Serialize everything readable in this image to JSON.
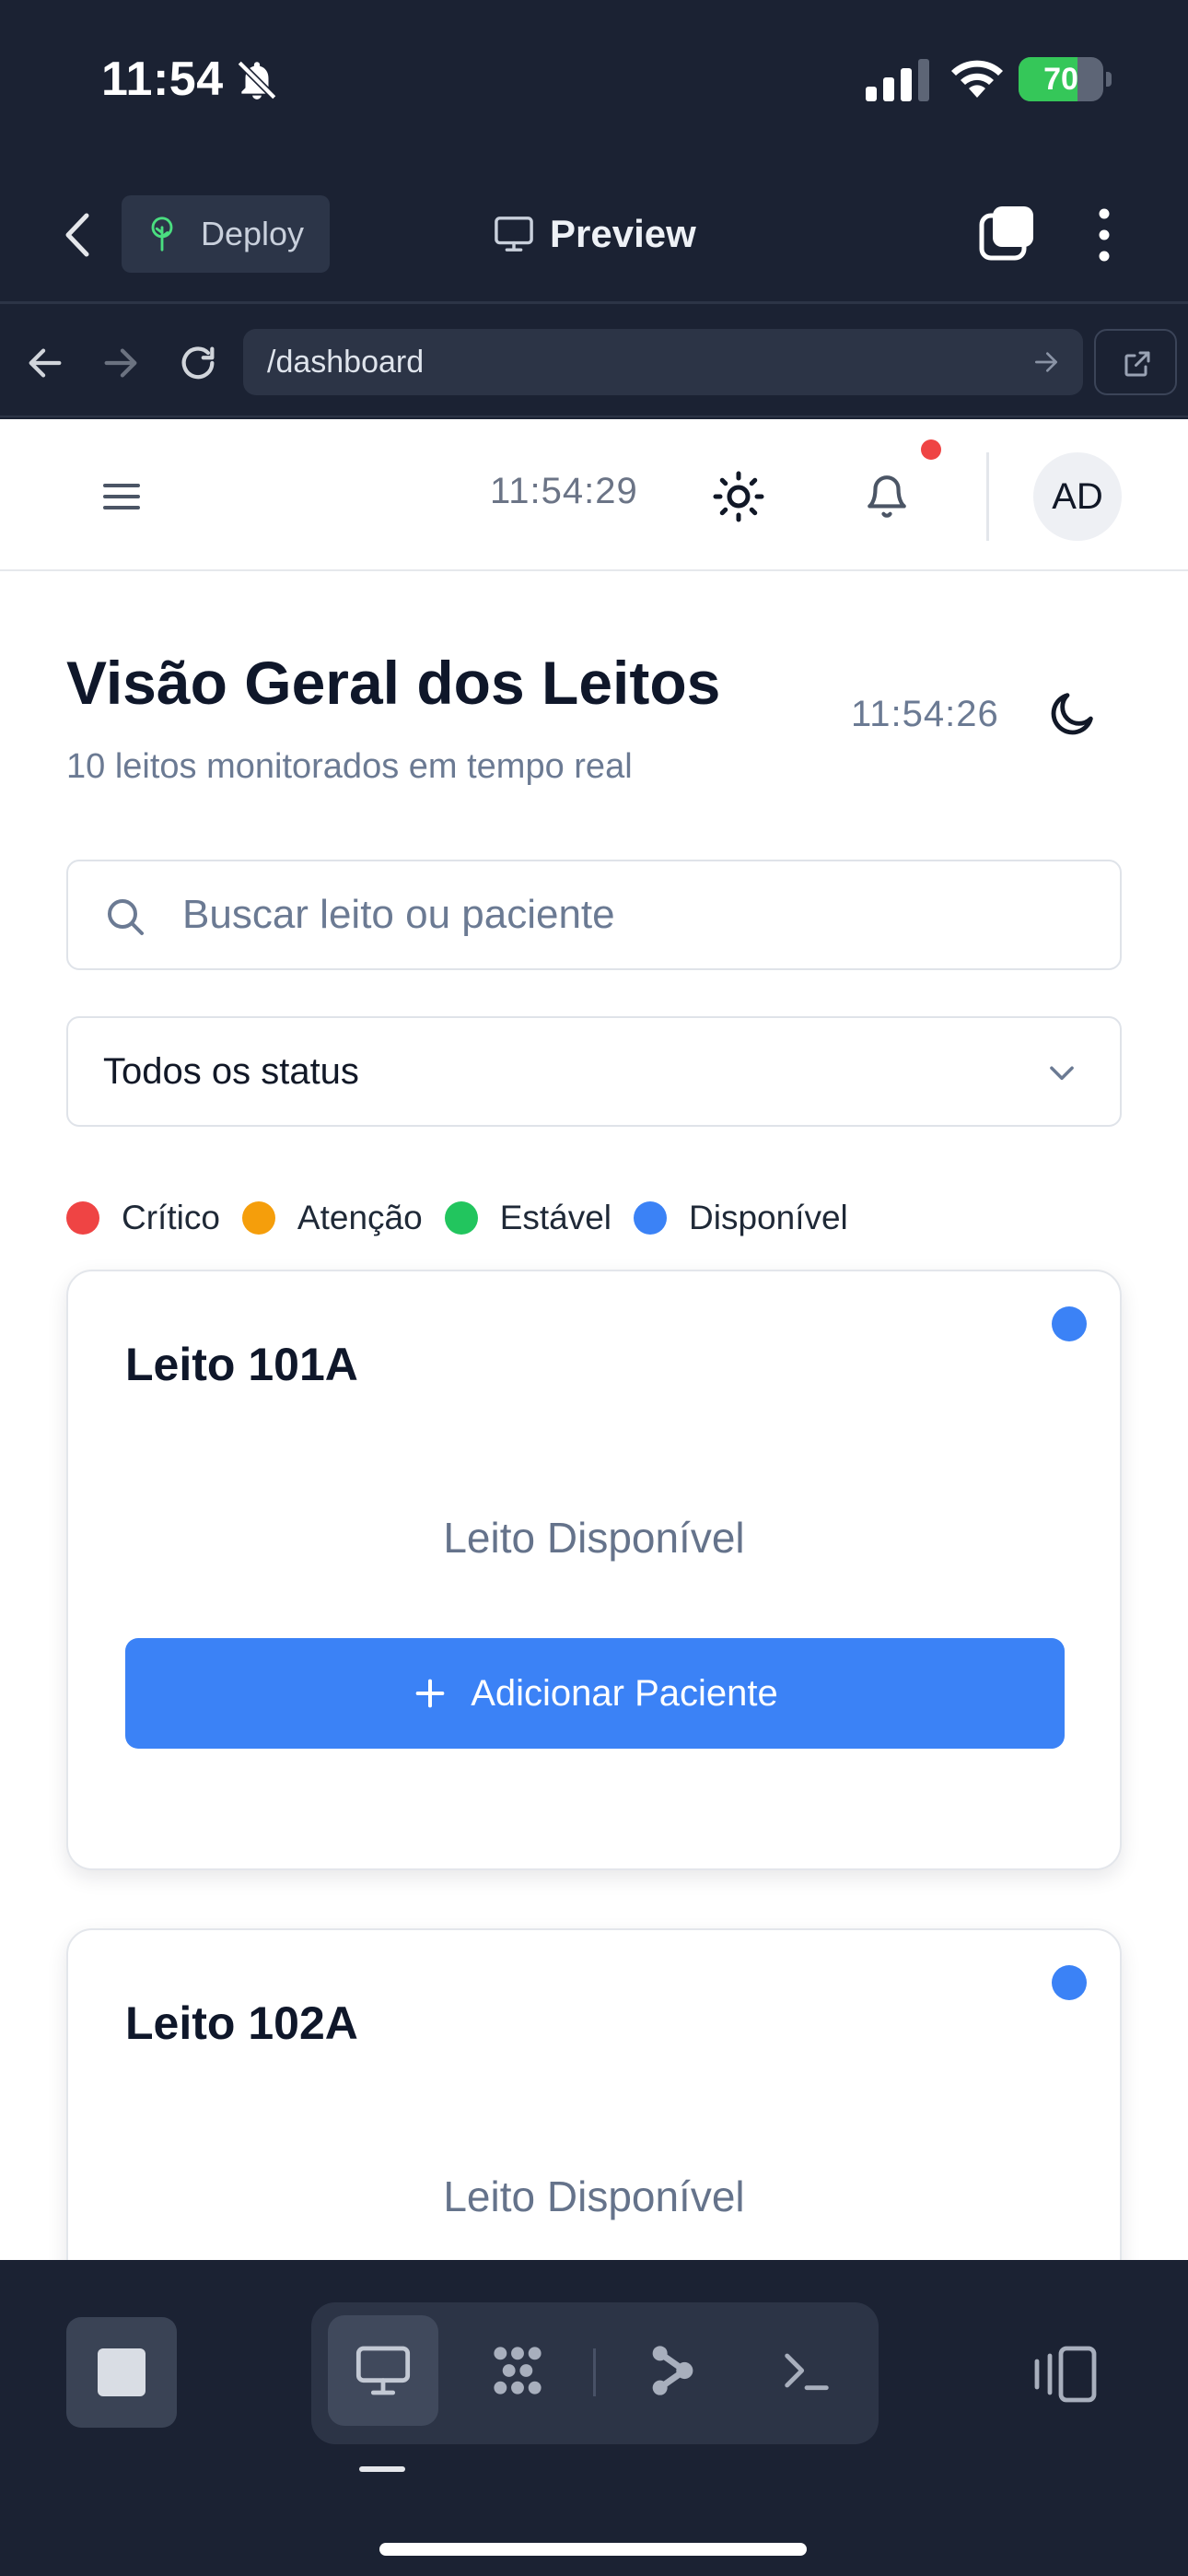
{
  "status_bar": {
    "time": "11:54",
    "battery_text": "70",
    "battery_level": 0.7,
    "icons": [
      "bell-slash-icon",
      "signal-icon",
      "wifi-icon",
      "battery-charging-icon"
    ]
  },
  "app_toolbar": {
    "back_icon": "chevron-left-icon",
    "deploy_label": "Deploy",
    "deploy_icon": "tree-icon",
    "preview_label": "Preview",
    "preview_icon": "monitor-icon",
    "tabs_icon": "tabs-icon",
    "more_icon": "more-vertical-icon"
  },
  "browser": {
    "url": "/dashboard",
    "icons": [
      "arrow-left-icon",
      "arrow-right-icon",
      "reload-icon",
      "go-arrow-icon",
      "external-link-icon"
    ]
  },
  "app_header": {
    "clock": "11:54:29",
    "avatar_initials": "AD",
    "notification_dot_color": "#ef4444"
  },
  "page": {
    "title": "Visão Geral dos Leitos",
    "subtitle": "10 leitos monitorados em tempo real",
    "clock": "11:54:26"
  },
  "search": {
    "placeholder": "Buscar leito ou paciente",
    "value": ""
  },
  "status_filter": {
    "selected": "Todos os status"
  },
  "legend": [
    {
      "label": "Crítico",
      "color": "#ef4444"
    },
    {
      "label": "Atenção",
      "color": "#f59e0b"
    },
    {
      "label": "Estável",
      "color": "#22c55e"
    },
    {
      "label": "Disponível",
      "color": "#3b82f6"
    }
  ],
  "beds": [
    {
      "name": "Leito 101A",
      "state": "Leito Disponível",
      "status_color": "#3b82f6",
      "action_label": "Adicionar Paciente"
    },
    {
      "name": "Leito 102A",
      "state": "Leito Disponível",
      "status_color": "#3b82f6"
    }
  ],
  "bottom_bar": {
    "buttons": [
      "stop-icon",
      "desktop-icon",
      "grid-dots-icon",
      "nodes-icon",
      "terminal-icon",
      "split-view-icon"
    ],
    "active": "desktop-icon"
  },
  "colors": {
    "chrome_bg": "#1b2233",
    "primary": "#3b82f6",
    "battery_green": "#35c759"
  }
}
